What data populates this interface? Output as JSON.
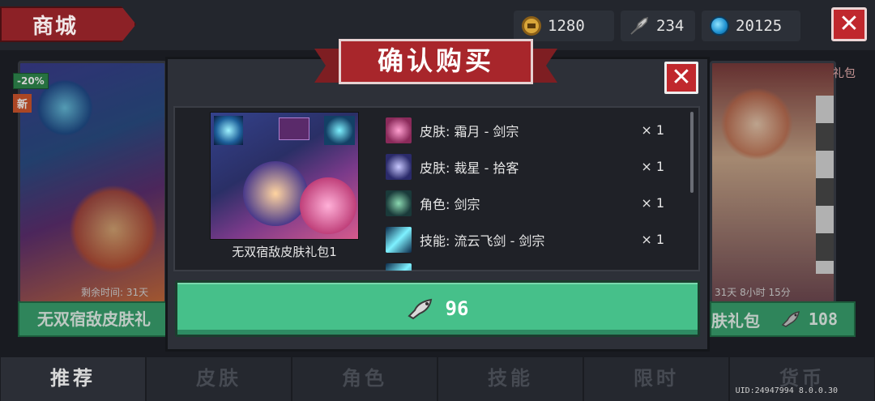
{
  "header": {
    "store_title": "商城",
    "coins": "1280",
    "feathers": "234",
    "gems": "20125"
  },
  "cards": {
    "left": {
      "discount_badge": "-20%",
      "new_badge": "新",
      "remaining_label": "剩余时间: 31天",
      "name": "无双宿敌皮肤礼"
    },
    "right": {
      "gift_badge": "礼包",
      "remaining_label": "31天 8小时 15分",
      "name": "肤礼包",
      "price": "108"
    }
  },
  "modal": {
    "title": "确认购买",
    "pack_name": "无双宿敌皮肤礼包1",
    "items": [
      {
        "label": "皮肤: 霜月 - 剑宗",
        "qty": "× 1",
        "icon": "skin-girl-icon"
      },
      {
        "label": "皮肤: 裁星 - 拾客",
        "qty": "× 1",
        "icon": "skin-hat-icon"
      },
      {
        "label": "角色: 剑宗",
        "qty": "× 1",
        "icon": "character-icon"
      },
      {
        "label": "技能: 流云飞剑 - 剑宗",
        "qty": "× 1",
        "icon": "skill-sword-icon"
      }
    ],
    "price": "96"
  },
  "tabs": [
    "推荐",
    "皮肤",
    "角色",
    "技能",
    "限时",
    "货币"
  ],
  "active_tab": "推荐",
  "uid": "UID:24947994 8.0.0.30",
  "colors": {
    "accent_red": "#a8262b",
    "buy_green": "#46c08a",
    "panel": "#2d3038"
  }
}
